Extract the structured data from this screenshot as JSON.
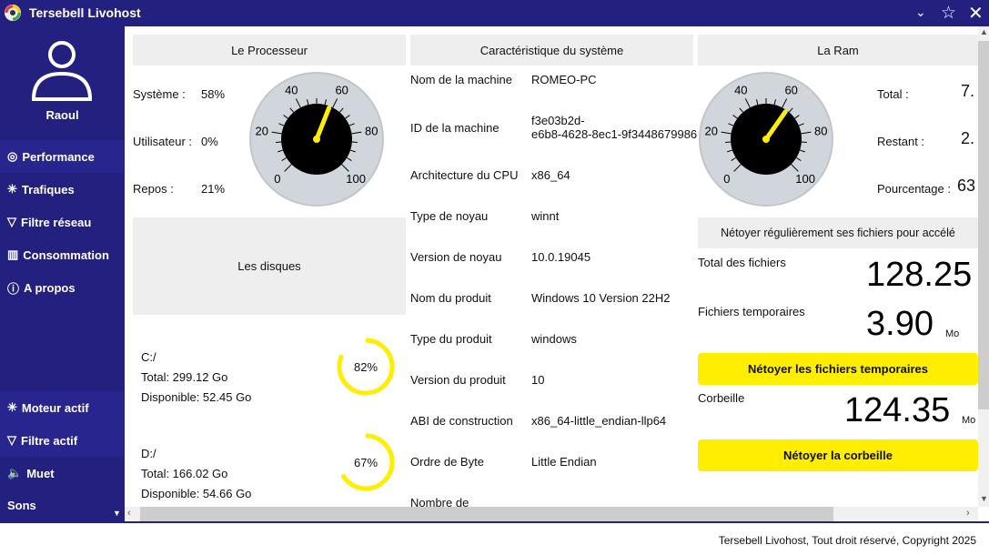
{
  "app": {
    "title": "Tersebell Livohost"
  },
  "user": {
    "name": "Raoul"
  },
  "sidebar": {
    "items": [
      {
        "label": "Performance",
        "icon": "performance-icon"
      },
      {
        "label": "Trafiques",
        "icon": "network-icon"
      },
      {
        "label": "Filtre réseau",
        "icon": "filter-icon"
      },
      {
        "label": "Consommation",
        "icon": "chart-icon"
      },
      {
        "label": "A propos",
        "icon": "info-icon"
      }
    ],
    "bottom": [
      {
        "label": "Moteur actif",
        "icon": "network-icon"
      },
      {
        "label": "Filtre actif",
        "icon": "filter-icon"
      },
      {
        "label": "Muet",
        "icon": "speaker-mute-icon"
      },
      {
        "label": "Sons"
      }
    ]
  },
  "processor": {
    "title": "Le Processeur",
    "rows": [
      {
        "label": "Système :",
        "value": "58%"
      },
      {
        "label": "Utilisateur :",
        "value": "0%"
      },
      {
        "label": "Repos :",
        "value": "21%"
      }
    ],
    "gauge_value": 58,
    "gauge_ticks": [
      "0",
      "20",
      "40",
      "60",
      "80",
      "100"
    ]
  },
  "disks": {
    "title": "Les disques",
    "items": [
      {
        "name": "C:/",
        "total": "Total: 299.12 Go",
        "free": "Disponible: 52.45 Go",
        "percent": 82,
        "percent_label": "82%"
      },
      {
        "name": "D:/",
        "total": "Total: 166.02 Go",
        "free": "Disponible: 54.66 Go",
        "percent": 67,
        "percent_label": "67%"
      }
    ]
  },
  "system": {
    "title": "Caractéristique du système",
    "rows": [
      {
        "label": "Nom de la machine",
        "value": "ROMEO-PC"
      },
      {
        "label": "ID de la machine",
        "value": "f3e03b2d-\ne6b8-4628-8ec1-9f3448679986"
      },
      {
        "label": "Architecture du CPU",
        "value": "x86_64"
      },
      {
        "label": "Type de noyau",
        "value": "winnt"
      },
      {
        "label": "Version de noyau",
        "value": "10.0.19045"
      },
      {
        "label": "Nom du produit",
        "value": "Windows 10 Version 22H2"
      },
      {
        "label": "Type du produit",
        "value": "windows"
      },
      {
        "label": "Version du produit",
        "value": "10"
      },
      {
        "label": "ABI de construction",
        "value": "x86_64-little_endian-llp64"
      },
      {
        "label": "Ordre de Byte",
        "value": "Little Endian"
      },
      {
        "label": "Nombre de",
        "value": ""
      }
    ]
  },
  "ram": {
    "title": "La Ram",
    "rows": [
      {
        "label": "Total :",
        "value": "7."
      },
      {
        "label": "Restant :",
        "value": "2."
      },
      {
        "label": "Pourcentage :",
        "value": "63"
      }
    ],
    "gauge_value": 63
  },
  "cleanup": {
    "banner": "Nétoyer régulièrement ses fichiers pour accélé",
    "total_label": "Total des fichiers",
    "total_value": "128.25",
    "temp_label": "Fichiers temporaires",
    "temp_value": "3.90",
    "temp_unit": "Mo",
    "clean_temp_button": "Nétoyer les fichiers temporaires",
    "trash_label": "Corbeille",
    "trash_value": "124.35",
    "trash_unit": "Mo",
    "clean_trash_button": "Nétoyer la corbeille"
  },
  "footer": {
    "text": "Tersebell Livohost, Tout droit réservé, Copyright  2025"
  },
  "colors": {
    "primary": "#23207f",
    "accent": "#ffee00"
  }
}
